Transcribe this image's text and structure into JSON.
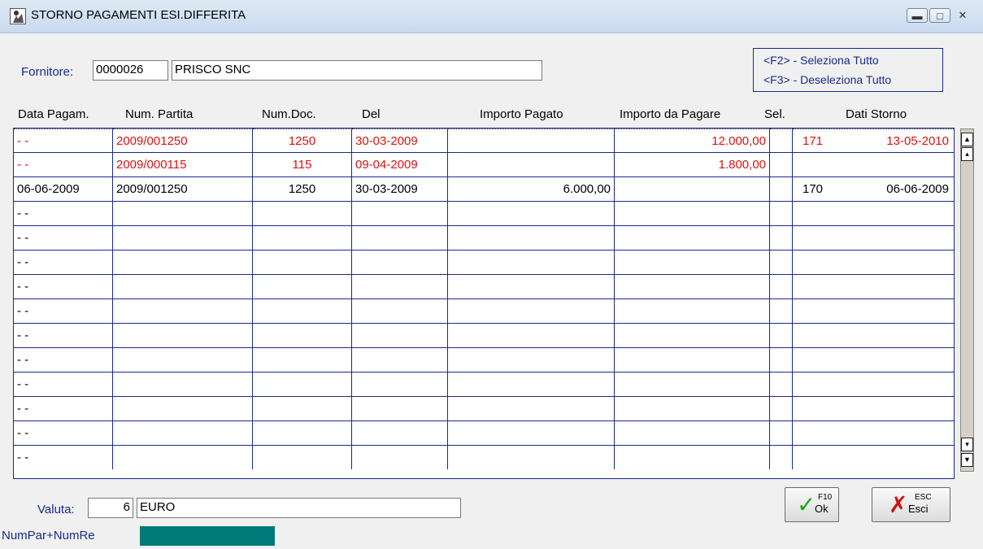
{
  "window": {
    "title": "STORNO PAGAMENTI ESI.DIFFERITA",
    "controls": [
      "minimize",
      "maximize",
      "close"
    ]
  },
  "supplier": {
    "label": "Fornitore:",
    "code": "0000026",
    "name": "PRISCO SNC"
  },
  "hotkeys": {
    "select_all": "<F2> - Seleziona Tutto",
    "deselect_all": "<F3> - Deseleziona Tutto"
  },
  "table": {
    "columns": {
      "data_pagam": "Data Pagam.",
      "num_partita": "Num. Partita",
      "num_doc": "Num.Doc.",
      "del": "Del",
      "importo_pagato": "Importo Pagato",
      "importo_da_pagare": "Importo da Pagare",
      "sel": "Sel.",
      "dati_storno": "Dati Storno"
    },
    "rows": [
      {
        "data_pagam": "- -",
        "num_partita": "2009/001250",
        "num_doc": "1250",
        "del": "30-03-2009",
        "importo_pagato": "",
        "importo_da_pagare": "12.000,00",
        "sel": "",
        "storno_num": "171",
        "storno_date": "13-05-2010",
        "highlight": "red"
      },
      {
        "data_pagam": "- -",
        "num_partita": "2009/000115",
        "num_doc": "115",
        "del": "09-04-2009",
        "importo_pagato": "",
        "importo_da_pagare": "1.800,00",
        "sel": "",
        "storno_num": "",
        "storno_date": "",
        "highlight": "red"
      },
      {
        "data_pagam": "06-06-2009",
        "num_partita": "2009/001250",
        "num_doc": "1250",
        "del": "30-03-2009",
        "importo_pagato": "6.000,00",
        "importo_da_pagare": "",
        "sel": "",
        "storno_num": "170",
        "storno_date": "06-06-2009",
        "highlight": "none"
      },
      {
        "data_pagam": "- -"
      },
      {
        "data_pagam": "- -"
      },
      {
        "data_pagam": "- -"
      },
      {
        "data_pagam": "- -"
      },
      {
        "data_pagam": "- -"
      },
      {
        "data_pagam": "- -"
      },
      {
        "data_pagam": "- -"
      },
      {
        "data_pagam": "- -"
      },
      {
        "data_pagam": "- -"
      },
      {
        "data_pagam": "- -"
      },
      {
        "data_pagam": "- -"
      }
    ]
  },
  "currency": {
    "label": "Valuta:",
    "code": "6",
    "name": "EURO"
  },
  "buttons": {
    "ok": {
      "key": "F10",
      "label": "Ok",
      "icon": "checkmark-icon"
    },
    "esci": {
      "key": "ESC",
      "label": "Esci",
      "icon": "x-icon"
    }
  },
  "footer": {
    "numpar_label": "NumPar+NumRe"
  },
  "colors": {
    "accent_navy": "#1a2a8c",
    "highlight_red": "#e01010",
    "status_teal": "#007a78",
    "ok_green": "#1aa81a",
    "cancel_red": "#d01010"
  }
}
